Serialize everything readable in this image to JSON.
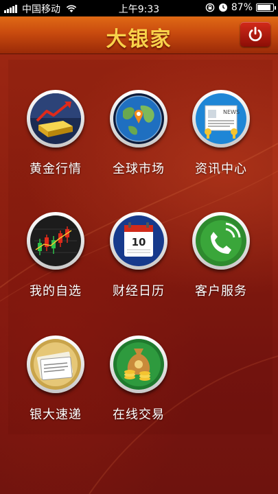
{
  "status_bar": {
    "carrier": "中国移动",
    "time": "上午9:33",
    "battery": "87%",
    "battery_level": 0.87
  },
  "header": {
    "title": "大银家",
    "power_icon": "power-icon"
  },
  "menu": [
    {
      "label": "黄金行情",
      "icon": "gold-bar-chart-icon"
    },
    {
      "label": "全球市场",
      "icon": "globe-location-icon"
    },
    {
      "label": "资讯中心",
      "icon": "newspaper-icon"
    },
    {
      "label": "我的自选",
      "icon": "candlestick-chart-icon"
    },
    {
      "label": "财经日历",
      "icon": "calendar-icon"
    },
    {
      "label": "客户服务",
      "icon": "phone-icon"
    },
    {
      "label": "银大速递",
      "icon": "news-paper-gold-icon"
    },
    {
      "label": "在线交易",
      "icon": "money-bag-icon"
    }
  ],
  "calendar_icon_day": "10",
  "newspaper_icon_text": "NEWS",
  "colors": {
    "header_orange": "#c84a0e",
    "title_gold": "#f8d24a",
    "background_red": "#8a1e10",
    "power_red": "#b31a10"
  }
}
